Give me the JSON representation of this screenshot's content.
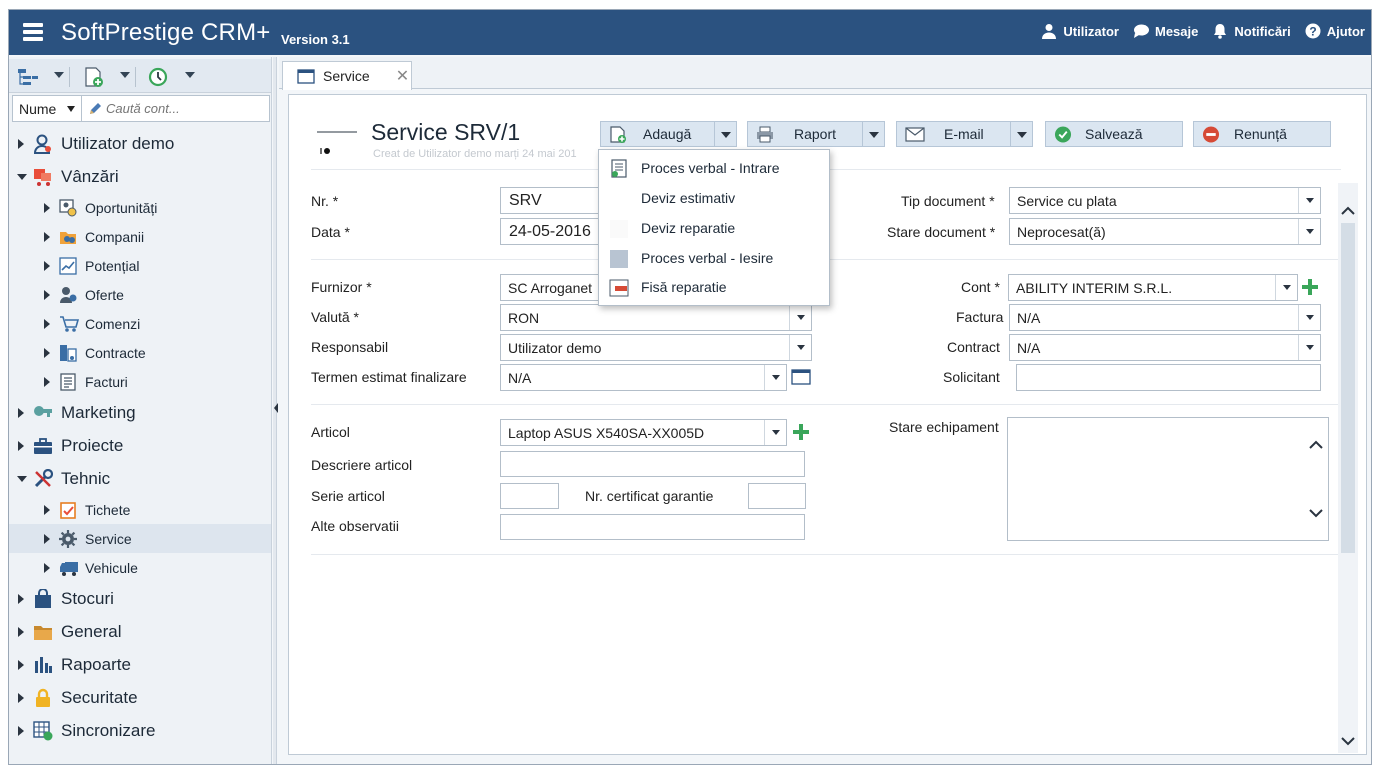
{
  "app": {
    "title": "SoftPrestige CRM+",
    "version": "Version 3.1",
    "links": {
      "user": "Utilizator",
      "messages": "Mesaje",
      "notifications": "Notificări",
      "help": "Ajutor"
    }
  },
  "sidebar": {
    "search_field": "Nume",
    "search_placeholder": "Caută cont...",
    "items": [
      {
        "label": "Utilizator demo"
      },
      {
        "label": "Vânzări"
      },
      {
        "label": "Oportunități"
      },
      {
        "label": "Companii"
      },
      {
        "label": "Potențial"
      },
      {
        "label": "Oferte"
      },
      {
        "label": "Comenzi"
      },
      {
        "label": "Contracte"
      },
      {
        "label": "Facturi"
      },
      {
        "label": "Marketing"
      },
      {
        "label": "Proiecte"
      },
      {
        "label": "Tehnic"
      },
      {
        "label": "Tichete"
      },
      {
        "label": "Service"
      },
      {
        "label": "Vehicule"
      },
      {
        "label": "Stocuri"
      },
      {
        "label": "General"
      },
      {
        "label": "Rapoarte"
      },
      {
        "label": "Securitate"
      },
      {
        "label": "Sincronizare"
      }
    ]
  },
  "tab": {
    "label": "Service",
    "close": "✕"
  },
  "document": {
    "title": "Service SRV/1",
    "subtitle": "Creat de Utilizator demo marți 24 mai 201"
  },
  "toolbar": {
    "add": "Adaugă",
    "report": "Raport",
    "email": "E-mail",
    "save": "Salvează",
    "cancel": "Renunță"
  },
  "add_menu": [
    {
      "label": "Proces verbal - Intrare"
    },
    {
      "label": "Deviz estimativ"
    },
    {
      "label": "Deviz reparatie"
    },
    {
      "label": "Proces verbal - Iesire"
    },
    {
      "label": "Fisă reparatie"
    }
  ],
  "form": {
    "nr": {
      "label": "Nr. *",
      "value": "SRV"
    },
    "data": {
      "label": "Data *",
      "value": "24-05-2016"
    },
    "tip_document": {
      "label": "Tip document *",
      "value": "Service cu plata"
    },
    "stare_document": {
      "label": "Stare document *",
      "value": "Neprocesat(ă)"
    },
    "furnizor": {
      "label": "Furnizor *",
      "value": "SC Arroganet"
    },
    "valuta": {
      "label": "Valută *",
      "value": "RON"
    },
    "responsabil": {
      "label": "Responsabil",
      "value": "Utilizator demo"
    },
    "termen": {
      "label": "Termen estimat finalizare",
      "value": "N/A"
    },
    "cont": {
      "label": "Cont *",
      "value": "ABILITY INTERIM S.R.L."
    },
    "factura": {
      "label": "Factura",
      "value": "N/A"
    },
    "contract": {
      "label": "Contract",
      "value": "N/A"
    },
    "solicitant": {
      "label": "Solicitant",
      "value": ""
    },
    "articol": {
      "label": "Articol",
      "value": "Laptop ASUS X540SA-XX005D"
    },
    "descriere": {
      "label": "Descriere articol",
      "value": ""
    },
    "serie": {
      "label": "Serie articol",
      "value": ""
    },
    "certificat": {
      "label": "Nr. certificat garantie",
      "value": ""
    },
    "observatii": {
      "label": "Alte observatii",
      "value": ""
    },
    "stare_echipament": {
      "label": "Stare echipament",
      "value": ""
    }
  },
  "colors": {
    "header": "#2b5280",
    "button": "#dbe6f1",
    "plus": "#3aa65a",
    "save_icon": "#3aa65a",
    "cancel_icon": "#d64a36"
  }
}
